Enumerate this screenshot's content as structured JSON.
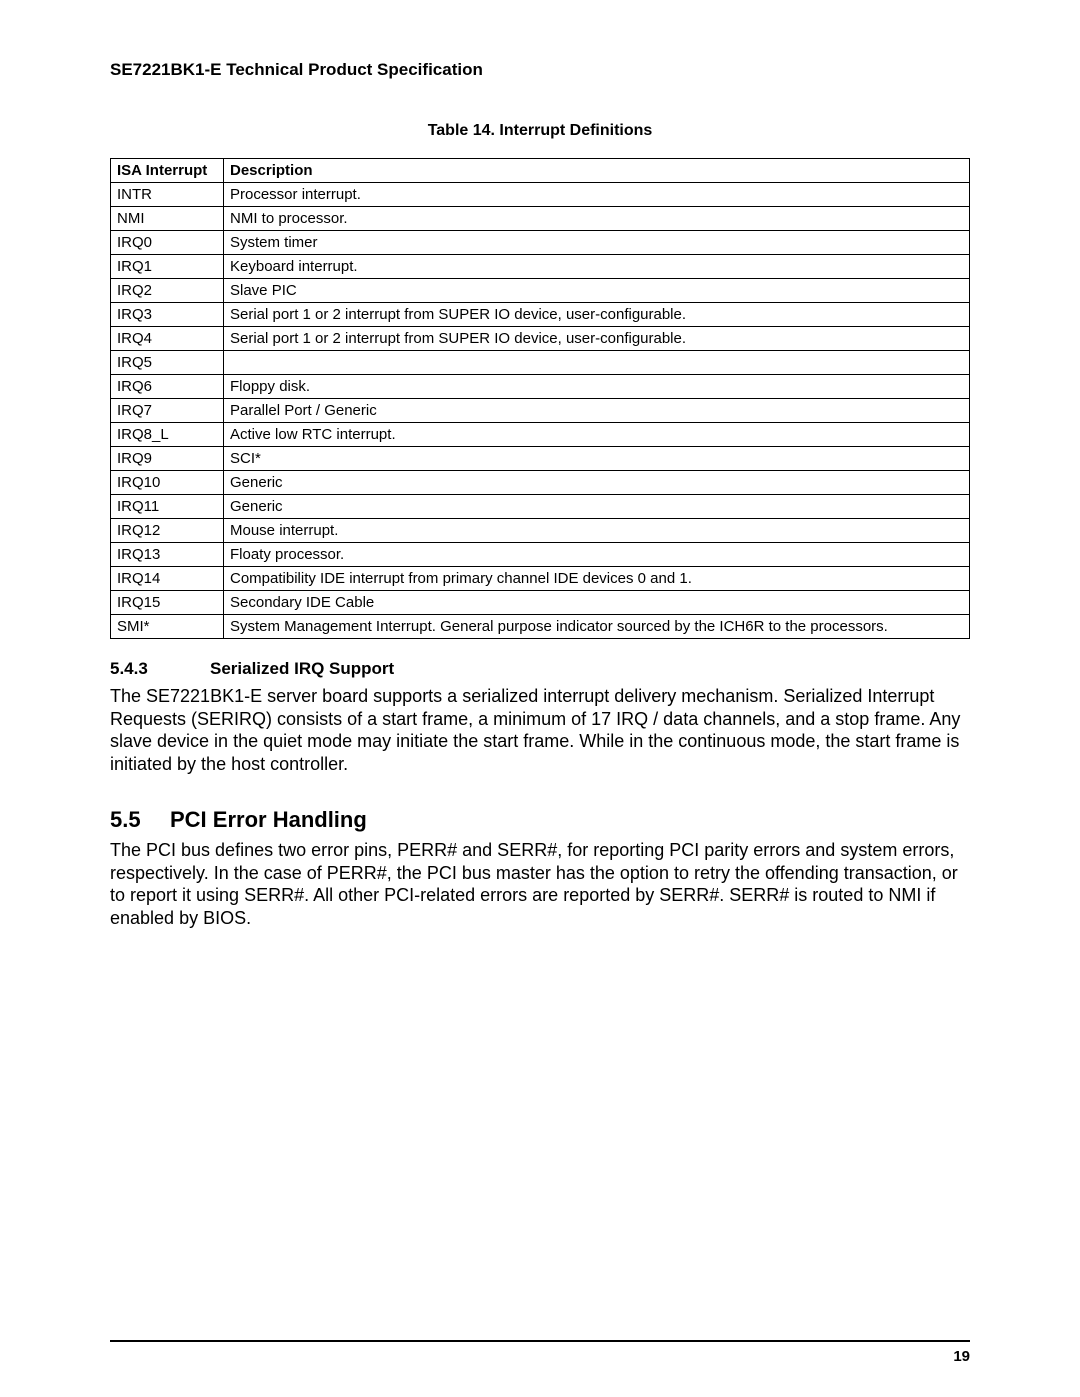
{
  "header": "SE7221BK1-E Technical Product Specification",
  "table": {
    "caption": "Table 14.  Interrupt Definitions",
    "col_a": "ISA Interrupt",
    "col_b": "Description",
    "rows": [
      {
        "a": "INTR",
        "b": "Processor interrupt."
      },
      {
        "a": "NMI",
        "b": "NMI to processor."
      },
      {
        "a": "IRQ0",
        "b": "System timer"
      },
      {
        "a": "IRQ1",
        "b": "Keyboard interrupt."
      },
      {
        "a": "IRQ2",
        "b": "Slave PIC"
      },
      {
        "a": "IRQ3",
        "b": "Serial port 1 or 2 interrupt from SUPER IO device, user-configurable."
      },
      {
        "a": "IRQ4",
        "b": "Serial port 1 or 2 interrupt from SUPER IO device, user-configurable."
      },
      {
        "a": "IRQ5",
        "b": ""
      },
      {
        "a": "IRQ6",
        "b": "Floppy disk."
      },
      {
        "a": "IRQ7",
        "b": "Parallel Port / Generic"
      },
      {
        "a": "IRQ8_L",
        "b": "Active low RTC interrupt."
      },
      {
        "a": "IRQ9",
        "b": "SCI*"
      },
      {
        "a": "IRQ10",
        "b": "Generic"
      },
      {
        "a": "IRQ11",
        "b": "Generic"
      },
      {
        "a": "IRQ12",
        "b": "Mouse interrupt."
      },
      {
        "a": "IRQ13",
        "b": "Floaty processor."
      },
      {
        "a": "IRQ14",
        "b": "Compatibility IDE interrupt from primary channel IDE devices 0 and 1."
      },
      {
        "a": "IRQ15",
        "b": "Secondary IDE Cable"
      },
      {
        "a": "SMI*",
        "b": "System Management Interrupt. General purpose indicator sourced by the ICH6R to the processors."
      }
    ]
  },
  "sec543": {
    "num": "5.4.3",
    "title": "Serialized IRQ Support",
    "body": "The SE7221BK1-E server board supports a serialized interrupt delivery mechanism. Serialized Interrupt Requests (SERIRQ) consists of a start frame, a minimum of 17 IRQ / data channels, and a stop frame. Any slave device in the quiet mode may initiate the start frame. While in the continuous mode, the start frame is initiated by the host controller."
  },
  "sec55": {
    "num": "5.5",
    "title": "PCI Error Handling",
    "body": "The PCI bus defines two error pins, PERR# and SERR#, for reporting PCI parity errors and system errors, respectively.  In the case of PERR#, the PCI bus master has the option to retry the offending transaction, or to report it using SERR#.  All other PCI-related errors are reported by SERR#.  SERR# is routed to NMI if enabled by BIOS."
  },
  "page_number": "19"
}
